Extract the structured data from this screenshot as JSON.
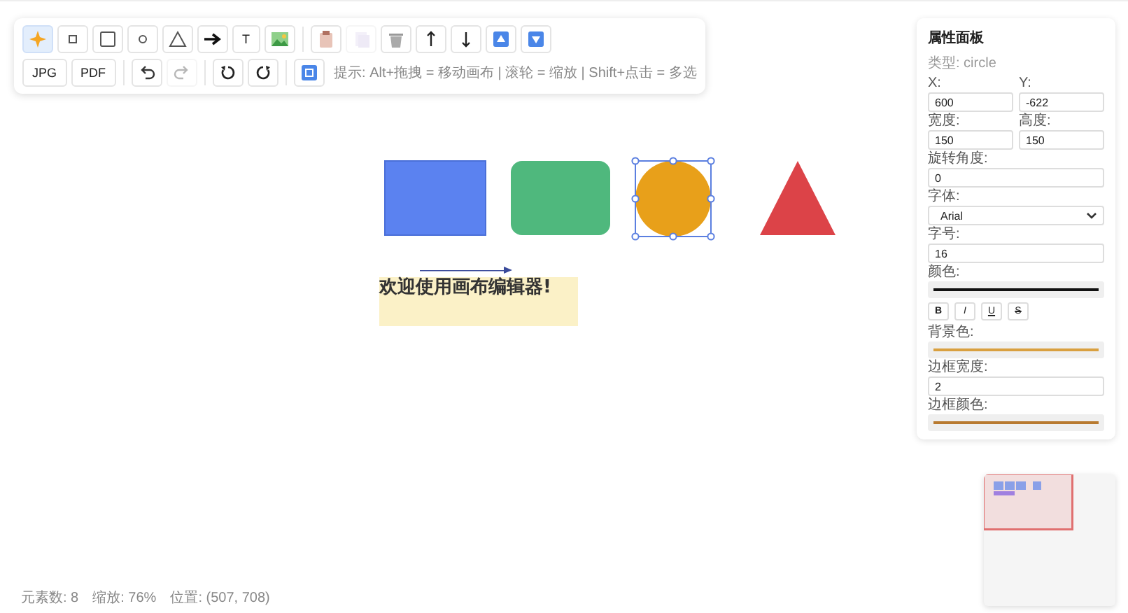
{
  "toolbar": {
    "rows": [
      [
        {
          "kind": "magic",
          "selected": true,
          "disabled": false
        },
        {
          "kind": "small-square",
          "selected": false,
          "disabled": false
        },
        {
          "kind": "square",
          "selected": false,
          "disabled": false
        },
        {
          "kind": "small-circle",
          "selected": false,
          "disabled": false
        },
        {
          "kind": "triangle",
          "selected": false,
          "disabled": false
        },
        {
          "kind": "arrow",
          "selected": false,
          "disabled": false
        },
        {
          "kind": "text",
          "label": "T",
          "selected": false,
          "disabled": false
        },
        {
          "kind": "image",
          "selected": false,
          "disabled": false
        },
        {
          "kind": "sep"
        },
        {
          "kind": "paste",
          "disabled": false
        },
        {
          "kind": "copy",
          "disabled": true
        },
        {
          "kind": "trash",
          "disabled": false
        },
        {
          "kind": "up",
          "disabled": false
        },
        {
          "kind": "down",
          "disabled": false
        },
        {
          "kind": "top",
          "disabled": false
        },
        {
          "kind": "bottom",
          "disabled": false
        }
      ],
      [
        {
          "kind": "text",
          "label": "JPG",
          "disabled": false
        },
        {
          "kind": "text",
          "label": "PDF",
          "disabled": false
        },
        {
          "kind": "sep"
        },
        {
          "kind": "undo",
          "disabled": false
        },
        {
          "kind": "redo",
          "disabled": true
        },
        {
          "kind": "sep"
        },
        {
          "kind": "rotate-left",
          "disabled": false
        },
        {
          "kind": "rotate-right",
          "disabled": false
        },
        {
          "kind": "sep"
        },
        {
          "kind": "fit",
          "disabled": false
        }
      ]
    ],
    "hint": "提示: Alt+拖拽 = 移动画布 | 滚轮 = 缩放 | Shift+点击 = 多选"
  },
  "canvas": {
    "elements": [
      {
        "kind": "rect",
        "color": "#5b82f0",
        "selected": false
      },
      {
        "kind": "roundrect",
        "color": "#4fb87d",
        "selected": false
      },
      {
        "kind": "circle",
        "color": "#e8a01a",
        "selected": true
      },
      {
        "kind": "triangle",
        "color": "#dc4348",
        "selected": false
      },
      {
        "kind": "arrow",
        "color": "#3a4a9a",
        "selected": false
      },
      {
        "kind": "text",
        "text": "欢迎使用画布编辑器!",
        "color": "#fbf1c7",
        "selected": false
      }
    ]
  },
  "panel": {
    "title": "属性面板",
    "type_line": "类型: circle",
    "fields": [
      {
        "kind": "pair",
        "items": [
          {
            "label": "X:",
            "value": "600"
          },
          {
            "label": "Y:",
            "value": "-622"
          }
        ]
      },
      {
        "kind": "pair",
        "items": [
          {
            "label": "宽度:",
            "value": "150"
          },
          {
            "label": "高度:",
            "value": "150"
          }
        ]
      },
      {
        "kind": "input",
        "label": "旋转角度:",
        "value": "0"
      },
      {
        "kind": "select",
        "label": "字体:",
        "value": "Arial"
      },
      {
        "kind": "input",
        "label": "字号:",
        "value": "16"
      },
      {
        "kind": "color",
        "label": "颜色:",
        "color": "#111111"
      },
      {
        "kind": "styles",
        "buttons": [
          {
            "label": "B"
          },
          {
            "label": "I"
          },
          {
            "label": "U"
          },
          {
            "label": "S"
          }
        ]
      },
      {
        "kind": "color",
        "label": "背景色:",
        "color": "#d9a040"
      },
      {
        "kind": "input",
        "label": "边框宽度:",
        "value": "2"
      },
      {
        "kind": "color",
        "label": "边框颜色:",
        "color": "#b87a30"
      }
    ]
  },
  "status_bar": [
    "元素数: 8",
    "缩放: 76%",
    "位置: (507, 708)"
  ]
}
